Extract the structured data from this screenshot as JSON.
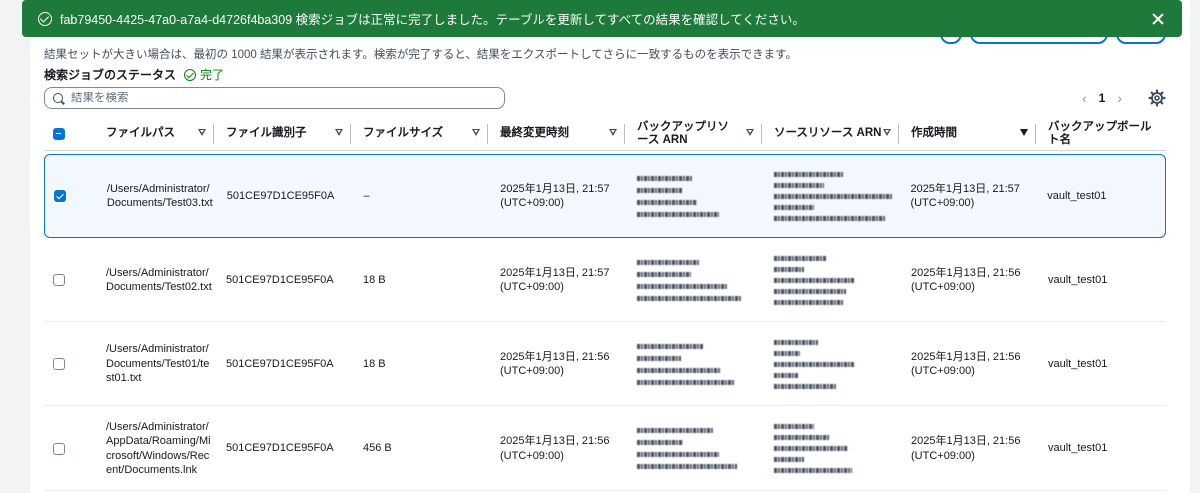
{
  "flash": {
    "message": "fab79450-4425-47a0-a7a4-d4726f4ba309 検索ジョブは正常に完了しました。テーブルを更新してすべての結果を確認してください。"
  },
  "description": "結果セットが大きい場合は、最初の 1000 結果が表示されます。検索が完了すると、結果をエクスポートしてさらに一致するものを表示できます。",
  "status": {
    "label": "検索ジョブのステータス",
    "value": "完了"
  },
  "search": {
    "placeholder": "結果を検索",
    "value": ""
  },
  "pagination": {
    "current_page": "1",
    "prev": "‹",
    "next": "›"
  },
  "colors": {
    "flash_bg": "#1e7a3a",
    "accent": "#0972d3",
    "success": "#037f0c"
  },
  "table": {
    "columns": [
      "ファイルパス",
      "ファイル識別子",
      "ファイルサイズ",
      "最終変更時刻",
      "バックアップリソース ARN",
      "ソースリソース ARN",
      "作成時間",
      "バックアップボールト名"
    ],
    "rows": [
      {
        "selected": true,
        "path": "/Users/Administrator/Documents/Test03.txt",
        "file_id": "501CE97D1CE95F0A",
        "size": "–",
        "modified": "2025年1月13日, 21:57 (UTC+09:00)",
        "created": "2025年1月13日, 21:57 (UTC+09:00)",
        "vault": "vault_test01"
      },
      {
        "selected": false,
        "path": "/Users/Administrator/Documents/Test02.txt",
        "file_id": "501CE97D1CE95F0A",
        "size": "18 B",
        "modified": "2025年1月13日, 21:57 (UTC+09:00)",
        "created": "2025年1月13日, 21:56 (UTC+09:00)",
        "vault": "vault_test01"
      },
      {
        "selected": false,
        "path": "/Users/Administrator/Documents/Test01/test01.txt",
        "file_id": "501CE97D1CE95F0A",
        "size": "18 B",
        "modified": "2025年1月13日, 21:56 (UTC+09:00)",
        "created": "2025年1月13日, 21:56 (UTC+09:00)",
        "vault": "vault_test01"
      },
      {
        "selected": false,
        "path": "/Users/Administrator/AppData/Roaming/Microsoft/Windows/Recent/Documents.lnk",
        "file_id": "501CE97D1CE95F0A",
        "size": "456 B",
        "modified": "2025年1月13日, 21:56 (UTC+09:00)",
        "created": "2025年1月13日, 21:56 (UTC+09:00)",
        "vault": "vault_test01"
      }
    ]
  }
}
